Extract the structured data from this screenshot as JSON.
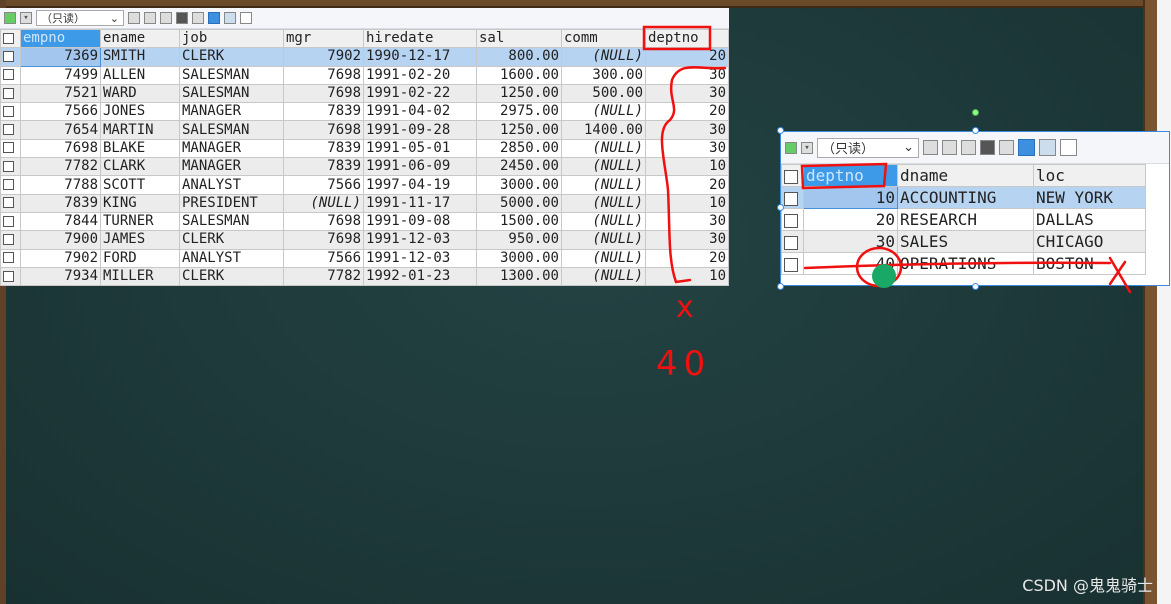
{
  "emp_table": {
    "toolbar": {
      "mode_select": "（只读）"
    },
    "columns": [
      "empno",
      "ename",
      "job",
      "mgr",
      "hiredate",
      "sal",
      "comm",
      "deptno"
    ],
    "rows": [
      [
        "7369",
        "SMITH",
        "CLERK",
        "7902",
        "1990-12-17",
        "800.00",
        "(NULL)",
        "20"
      ],
      [
        "7499",
        "ALLEN",
        "SALESMAN",
        "7698",
        "1991-02-20",
        "1600.00",
        "300.00",
        "30"
      ],
      [
        "7521",
        "WARD",
        "SALESMAN",
        "7698",
        "1991-02-22",
        "1250.00",
        "500.00",
        "30"
      ],
      [
        "7566",
        "JONES",
        "MANAGER",
        "7839",
        "1991-04-02",
        "2975.00",
        "(NULL)",
        "20"
      ],
      [
        "7654",
        "MARTIN",
        "SALESMAN",
        "7698",
        "1991-09-28",
        "1250.00",
        "1400.00",
        "30"
      ],
      [
        "7698",
        "BLAKE",
        "MANAGER",
        "7839",
        "1991-05-01",
        "2850.00",
        "(NULL)",
        "30"
      ],
      [
        "7782",
        "CLARK",
        "MANAGER",
        "7839",
        "1991-06-09",
        "2450.00",
        "(NULL)",
        "10"
      ],
      [
        "7788",
        "SCOTT",
        "ANALYST",
        "7566",
        "1997-04-19",
        "3000.00",
        "(NULL)",
        "20"
      ],
      [
        "7839",
        "KING",
        "PRESIDENT",
        "(NULL)",
        "1991-11-17",
        "5000.00",
        "(NULL)",
        "10"
      ],
      [
        "7844",
        "TURNER",
        "SALESMAN",
        "7698",
        "1991-09-08",
        "1500.00",
        "(NULL)",
        "30"
      ],
      [
        "7900",
        "JAMES",
        "CLERK",
        "7698",
        "1991-12-03",
        "950.00",
        "(NULL)",
        "30"
      ],
      [
        "7902",
        "FORD",
        "ANALYST",
        "7566",
        "1991-12-03",
        "3000.00",
        "(NULL)",
        "20"
      ],
      [
        "7934",
        "MILLER",
        "CLERK",
        "7782",
        "1992-01-23",
        "1300.00",
        "(NULL)",
        "10"
      ]
    ]
  },
  "dept_table": {
    "toolbar": {
      "mode_select": "（只读）"
    },
    "columns": [
      "deptno",
      "dname",
      "loc"
    ],
    "rows": [
      [
        "10",
        "ACCOUNTING",
        "NEW YORK"
      ],
      [
        "20",
        "RESEARCH",
        "DALLAS"
      ],
      [
        "30",
        "SALES",
        "CHICAGO"
      ],
      [
        "40",
        "OPERATIONS",
        "BOSTON"
      ]
    ]
  },
  "annotations": {
    "x_mark": "x",
    "number": "40",
    "color": "#f01010"
  },
  "watermark": "CSDN @鬼鬼骑士"
}
